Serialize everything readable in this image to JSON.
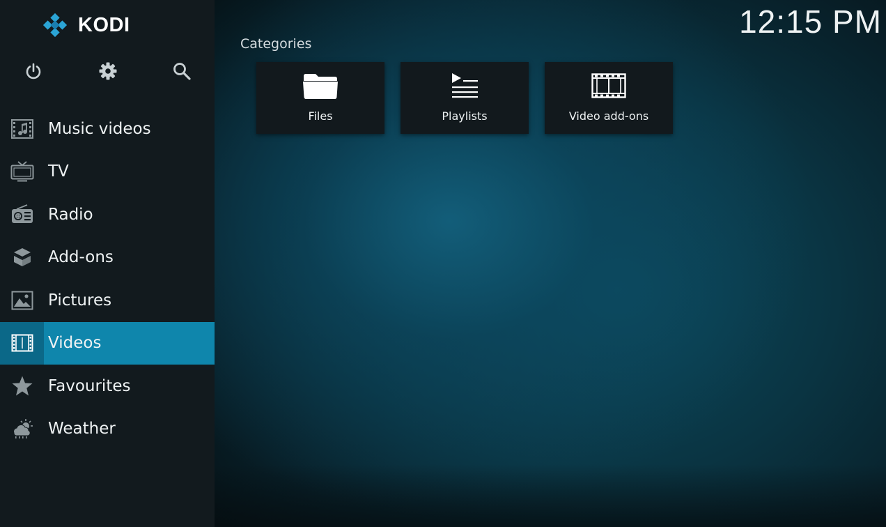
{
  "app": {
    "logo_text": "KODI",
    "clock": "12:15 PM",
    "accent_color": "#0f86ac"
  },
  "top_icons": [
    {
      "name": "power-icon"
    },
    {
      "name": "gear-icon"
    },
    {
      "name": "search-icon"
    }
  ],
  "sidebar": {
    "items": [
      {
        "label": "Music videos",
        "icon": "music-video-icon",
        "active": false
      },
      {
        "label": "TV",
        "icon": "tv-icon",
        "active": false
      },
      {
        "label": "Radio",
        "icon": "radio-icon",
        "active": false
      },
      {
        "label": "Add-ons",
        "icon": "addons-box-icon",
        "active": false
      },
      {
        "label": "Pictures",
        "icon": "picture-icon",
        "active": false
      },
      {
        "label": "Videos",
        "icon": "film-icon",
        "active": true
      },
      {
        "label": "Favourites",
        "icon": "star-icon",
        "active": false
      },
      {
        "label": "Weather",
        "icon": "weather-icon",
        "active": false
      }
    ]
  },
  "main": {
    "section_title": "Categories",
    "tiles": [
      {
        "label": "Files",
        "icon": "folder-icon"
      },
      {
        "label": "Playlists",
        "icon": "playlist-icon"
      },
      {
        "label": "Video add-ons",
        "icon": "film-strip-icon"
      }
    ]
  }
}
